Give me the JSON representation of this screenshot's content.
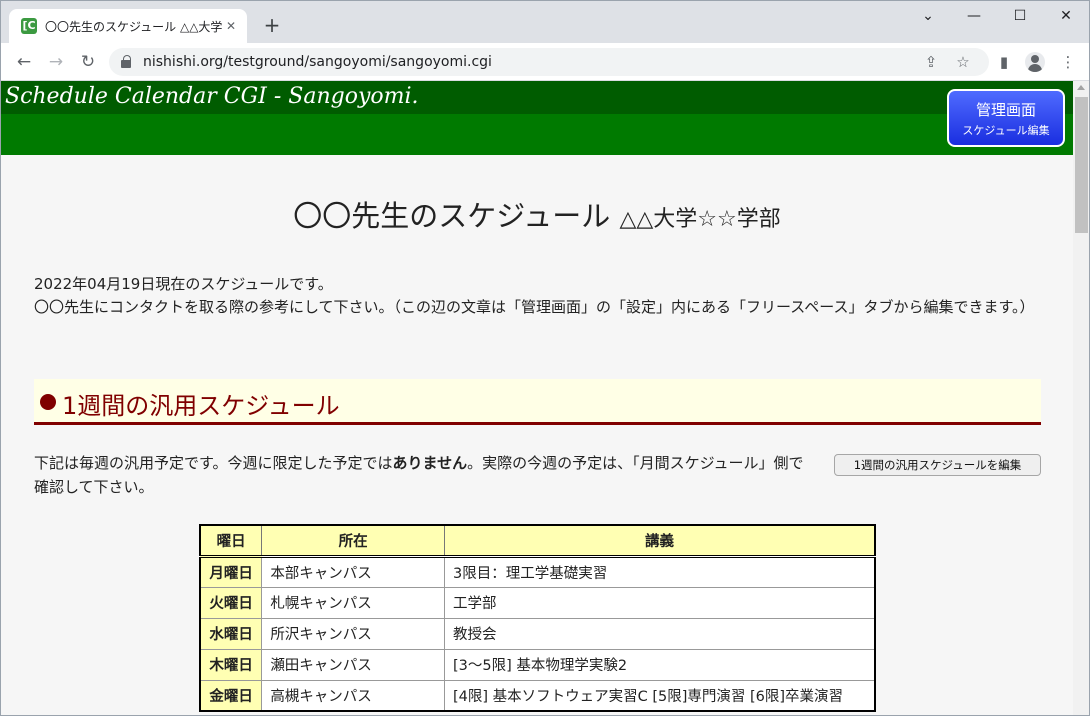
{
  "browser": {
    "tab_title": "〇〇先生のスケジュール △△大学☆☆学部",
    "favicon_glyph": "[C",
    "url": "nishishi.org/testground/sangoyomi/sangoyomi.cgi"
  },
  "header": {
    "site_title": "Schedule Calendar CGI - Sangoyomi.",
    "admin_main": "管理画面",
    "admin_sub": "スケジュール編集"
  },
  "page": {
    "title_main": "〇〇先生のスケジュール",
    "title_sub": "△△大学☆☆学部",
    "intro_line1": "2022年04月19日現在のスケジュールです。",
    "intro_line2": "〇〇先生にコンタクトを取る際の参考にして下さい。（この辺の文章は「管理画面」の「設定」内にある「フリースペース」タブから編集できます。）"
  },
  "section": {
    "heading": "1週間の汎用スケジュール",
    "notice_before": "下記は毎週の汎用予定です。今週に限定した予定では",
    "notice_bold": "ありません",
    "notice_after": "。実際の今週の予定は、「月間スケジュール」側で確認して下さい。",
    "edit_button": "1週間の汎用スケジュールを編集"
  },
  "schedule": {
    "headers": [
      "曜日",
      "所在",
      "講義"
    ],
    "rows": [
      {
        "day": "月曜日",
        "place": "本部キャンパス",
        "lecture": "3限目：理工学基礎実習"
      },
      {
        "day": "火曜日",
        "place": "札幌キャンパス",
        "lecture": "工学部"
      },
      {
        "day": "水曜日",
        "place": "所沢キャンパス",
        "lecture": "教授会"
      },
      {
        "day": "木曜日",
        "place": "瀬田キャンパス",
        "lecture": "[3～5限] 基本物理学実験2"
      },
      {
        "day": "金曜日",
        "place": "高槻キャンパス",
        "lecture": "[4限] 基本ソフトウェア実習C [5限]専門演習 [6限]卒業演習"
      }
    ]
  },
  "icons": {
    "close": "✕",
    "plus": "+",
    "back": "←",
    "forward": "→",
    "reload": "↻",
    "share": "⇪",
    "star": "☆",
    "sidepanel": "▮",
    "menu": "⋮",
    "chevron": "⌄",
    "minimize": "—",
    "maximize": "☐",
    "win_close": "✕"
  },
  "colors": {
    "header_green": "#007a00",
    "header_dark_green": "#005c00",
    "section_maroon": "#800000",
    "table_header_yellow": "#ffffb3",
    "admin_blue": "#1a2ee0"
  }
}
